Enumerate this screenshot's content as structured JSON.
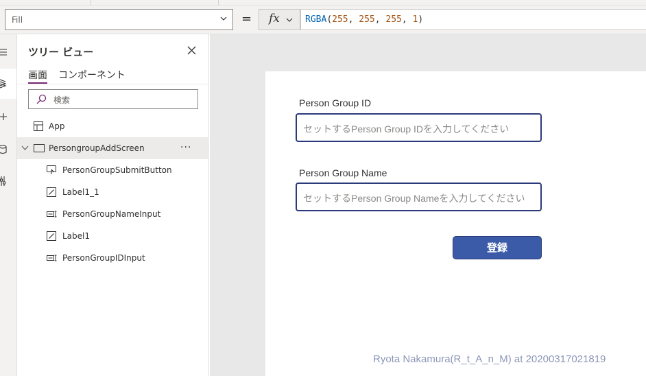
{
  "formula_bar": {
    "property": "Fill",
    "equals": "=",
    "fx_label": "fx",
    "formula": {
      "fn": "RGBA",
      "open": "(",
      "a": "255",
      "sep1": ", ",
      "b": "255",
      "sep2": ", ",
      "c": "255",
      "sep3": ", ",
      "d": "1",
      "close": ")"
    }
  },
  "tree_view": {
    "title": "ツリー ビュー",
    "tabs": [
      {
        "label": "画面",
        "active": true
      },
      {
        "label": "コンポーネント",
        "active": false
      }
    ],
    "search_placeholder": "検索",
    "nodes": [
      {
        "label": "App",
        "icon": "app-icon"
      },
      {
        "label": "PersongroupAddScreen",
        "icon": "screen-icon",
        "more": "···"
      },
      {
        "label": "PersonGroupSubmitButton",
        "icon": "button-icon"
      },
      {
        "label": "Label1_1",
        "icon": "label-icon"
      },
      {
        "label": "PersonGroupNameInput",
        "icon": "text-input-icon"
      },
      {
        "label": "Label1",
        "icon": "label-icon"
      },
      {
        "label": "PersonGroupIDInput",
        "icon": "text-input-icon"
      }
    ]
  },
  "form": {
    "group_id_label": "Person Group ID",
    "group_id_placeholder": "セットするPerson Group IDを入力してください",
    "group_name_label": "Person Group Name",
    "group_name_placeholder": "セットするPerson Group Nameを入力してください",
    "submit_label": "登録"
  },
  "watermark": "Ryota Nakamura(R_t_A_n_M) at 20200317021819",
  "colors": {
    "accent": "#742774",
    "input_border": "#2b3a7a",
    "button_fill": "#3b5aa8",
    "canvas_bg": "#e8e8e8"
  }
}
